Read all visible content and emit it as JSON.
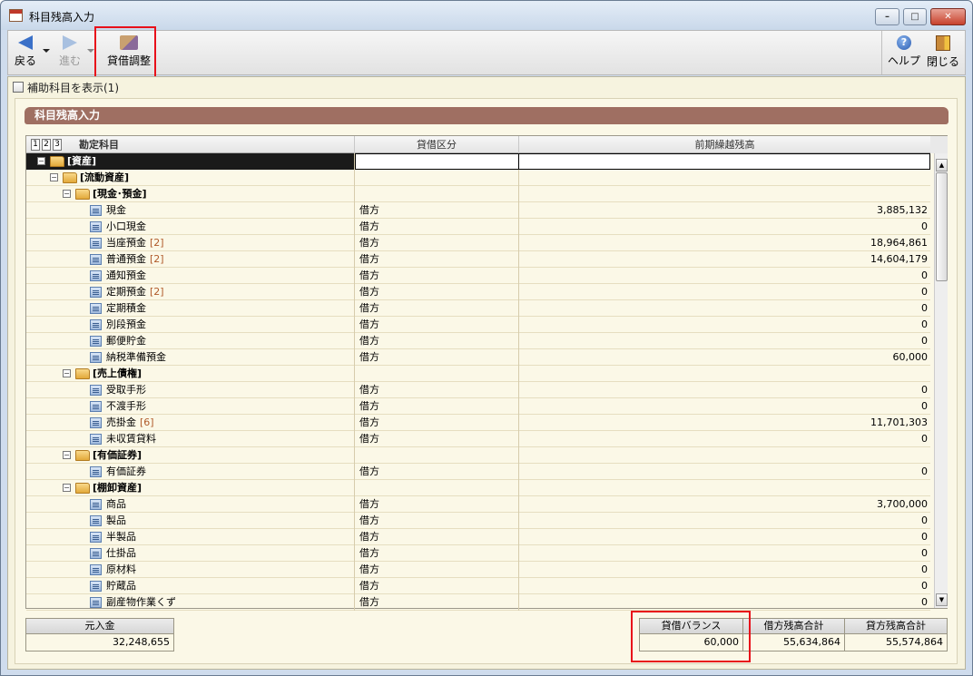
{
  "window": {
    "title": "科目残高入力",
    "minimize": "–",
    "maximize": "□",
    "close": "✕"
  },
  "toolbar": {
    "back": "戻る",
    "forward": "進む",
    "adjust": "貸借調整",
    "help": "ヘルプ",
    "help_glyph": "?",
    "close": "閉じる"
  },
  "options": {
    "show_sub_accounts": "補助科目を表示(1)"
  },
  "panel": {
    "banner": "科目残高入力"
  },
  "grid": {
    "levels": [
      "1",
      "2",
      "3"
    ],
    "columns": [
      "勘定科目",
      "貸借区分",
      "前期繰越残高"
    ],
    "rows": [
      {
        "depth": 0,
        "type": "group",
        "name": "[資産]",
        "side": "",
        "amount": "",
        "selected": true
      },
      {
        "depth": 1,
        "type": "group",
        "name": "[流動資産]",
        "side": "",
        "amount": ""
      },
      {
        "depth": 2,
        "type": "group",
        "name": "[現金･預金]",
        "side": "",
        "amount": ""
      },
      {
        "depth": 3,
        "type": "item",
        "name": "現金",
        "sub": "",
        "side": "借方",
        "amount": "3,885,132"
      },
      {
        "depth": 3,
        "type": "item",
        "name": "小口現金",
        "sub": "",
        "side": "借方",
        "amount": "0"
      },
      {
        "depth": 3,
        "type": "item",
        "name": "当座預金",
        "sub": "[2]",
        "side": "借方",
        "amount": "18,964,861"
      },
      {
        "depth": 3,
        "type": "item",
        "name": "普通預金",
        "sub": "[2]",
        "side": "借方",
        "amount": "14,604,179"
      },
      {
        "depth": 3,
        "type": "item",
        "name": "通知預金",
        "sub": "",
        "side": "借方",
        "amount": "0"
      },
      {
        "depth": 3,
        "type": "item",
        "name": "定期預金",
        "sub": "[2]",
        "side": "借方",
        "amount": "0"
      },
      {
        "depth": 3,
        "type": "item",
        "name": "定期積金",
        "sub": "",
        "side": "借方",
        "amount": "0"
      },
      {
        "depth": 3,
        "type": "item",
        "name": "別段預金",
        "sub": "",
        "side": "借方",
        "amount": "0"
      },
      {
        "depth": 3,
        "type": "item",
        "name": "郵便貯金",
        "sub": "",
        "side": "借方",
        "amount": "0"
      },
      {
        "depth": 3,
        "type": "item",
        "name": "納税準備預金",
        "sub": "",
        "side": "借方",
        "amount": "60,000"
      },
      {
        "depth": 2,
        "type": "group",
        "name": "[売上債権]",
        "side": "",
        "amount": ""
      },
      {
        "depth": 3,
        "type": "item",
        "name": "受取手形",
        "sub": "",
        "side": "借方",
        "amount": "0"
      },
      {
        "depth": 3,
        "type": "item",
        "name": "不渡手形",
        "sub": "",
        "side": "借方",
        "amount": "0"
      },
      {
        "depth": 3,
        "type": "item",
        "name": "売掛金",
        "sub": "[6]",
        "side": "借方",
        "amount": "11,701,303"
      },
      {
        "depth": 3,
        "type": "item",
        "name": "未収賃貸料",
        "sub": "",
        "side": "借方",
        "amount": "0"
      },
      {
        "depth": 2,
        "type": "group",
        "name": "[有価証券]",
        "side": "",
        "amount": ""
      },
      {
        "depth": 3,
        "type": "item",
        "name": "有価証券",
        "sub": "",
        "side": "借方",
        "amount": "0"
      },
      {
        "depth": 2,
        "type": "group",
        "name": "[棚卸資産]",
        "side": "",
        "amount": ""
      },
      {
        "depth": 3,
        "type": "item",
        "name": "商品",
        "sub": "",
        "side": "借方",
        "amount": "3,700,000"
      },
      {
        "depth": 3,
        "type": "item",
        "name": "製品",
        "sub": "",
        "side": "借方",
        "amount": "0"
      },
      {
        "depth": 3,
        "type": "item",
        "name": "半製品",
        "sub": "",
        "side": "借方",
        "amount": "0"
      },
      {
        "depth": 3,
        "type": "item",
        "name": "仕掛品",
        "sub": "",
        "side": "借方",
        "amount": "0"
      },
      {
        "depth": 3,
        "type": "item",
        "name": "原材料",
        "sub": "",
        "side": "借方",
        "amount": "0"
      },
      {
        "depth": 3,
        "type": "item",
        "name": "貯蔵品",
        "sub": "",
        "side": "借方",
        "amount": "0"
      },
      {
        "depth": 3,
        "type": "item",
        "name": "副産物作業くず",
        "sub": "",
        "side": "借方",
        "amount": "0"
      }
    ]
  },
  "summary": {
    "capital_label": "元入金",
    "capital_value": "32,248,655",
    "balance_label": "貸借バランス",
    "balance_value": "60,000",
    "debit_total_label": "借方残高合計",
    "debit_total_value": "55,634,864",
    "credit_total_label": "貸方残高合計",
    "credit_total_value": "55,574,864"
  },
  "colors": {
    "banner": "#9f6f62",
    "highlight_box": "#e8101a",
    "client_bg": "#f6f3df"
  }
}
